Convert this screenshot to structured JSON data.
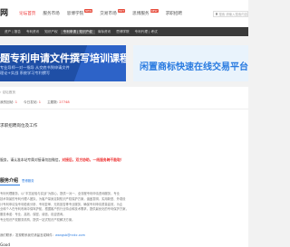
{
  "header": {
    "logo": "网",
    "nav": [
      {
        "label": "论坛首页",
        "active": true,
        "badge": ""
      },
      {
        "label": "服务市场",
        "active": false,
        "badge": ""
      },
      {
        "label": "思博学院",
        "active": false,
        "badge": "NEW"
      },
      {
        "label": "交易市场",
        "active": false,
        "badge": "HOT"
      },
      {
        "label": "思博服务",
        "active": false,
        "badge": "NEW"
      },
      {
        "label": "求职招聘",
        "active": false,
        "badge": ""
      }
    ],
    "search_placeholder": "搜索 请输入搜索内容"
  },
  "subnav": [
    {
      "label": "资产 | 报告",
      "hl": false
    },
    {
      "label": "专利资讯",
      "hl": false
    },
    {
      "label": "知识产权",
      "hl": false
    },
    {
      "label": "专利申请 | 知识产权",
      "hl": true
    },
    {
      "label": "商标资讯",
      "hl": false
    },
    {
      "label": "思博学院",
      "hl": false
    },
    {
      "label": "专利代理 | 考试",
      "hl": false
    }
  ],
  "banners": {
    "left": {
      "title": "题专利申请文件撰写培训课程",
      "sub": "专业导师一对一指导 从交底书到申请文件",
      "sub2": "理论+实战 系统学习专利撰写"
    },
    "right": {
      "title": "闲置商标快速在线交易平台"
    }
  },
  "main": {
    "breadcrumb": "› 论坛首页",
    "stats": [
      {
        "label": "我的回帖:",
        "value": "1"
      },
      {
        "label": "今日发帖:",
        "value": "1"
      },
      {
        "label": "主题数:",
        "value": "27748"
      }
    ],
    "post_title": "求职招聘岗位及工作",
    "warning_prefix": "服务，请认准本站专属对接请勿加微信，",
    "warning_red": "对接后，双方协助，一线服务跨不能取！",
    "svc_title": "服务介绍",
    "svc_sub": "思博服务",
    "svc_lines": [
      "专利代理服务，以“丰富经验与实战”为核心，提供一对一、全流程专利申请咨询服务，专业",
      "技术背景的专利代理人团队，为客户量身定制知识产权保护方案，涵盖发明、实用新型、外观设",
      "计专利申请及专利检索分析、专利复审、无效宣告等专业服务，确保专利申请质量高效，为企",
      "业和个人在专利布局中保驾护航，根据客户的行业特点和技术需求，提供最优化的专利保护方案，",
      "服务承诺：专业、高效、保密、诚信，欢迎咨询。",
      "专业知识产权服务机构，提供一站式知识产权解决方案。"
    ],
    "contact_prefix": "我们联系：发现联系我们请留言或邮件：",
    "contact_mail": "wangsb@nnkc.com",
    "footer_name": "Good"
  }
}
